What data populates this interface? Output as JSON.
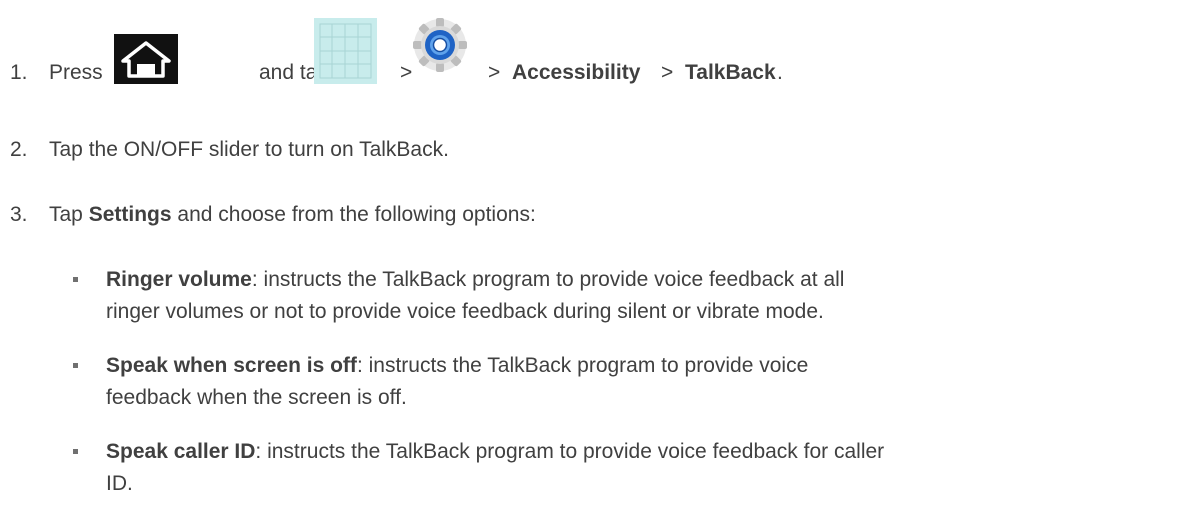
{
  "steps": [
    {
      "number": "1.",
      "press": "Press",
      "and_tap": "and tap",
      "sep1": ">",
      "sep2": ">",
      "accessibility": "Accessibility",
      "sep3": ">",
      "talkback": "TalkBack",
      "end": ".",
      "icons": [
        "home-icon",
        "apps-grid-icon",
        "settings-gear-icon"
      ]
    },
    {
      "number": "2.",
      "text": "Tap the ON/OFF slider to turn on TalkBack."
    },
    {
      "number": "3.",
      "tap": "Tap",
      "settings": "Settings",
      "rest": "and choose from the following options:"
    }
  ],
  "options": [
    {
      "term": "Ringer volume",
      "line1": ": instructs the TalkBack program to provide voice feedback at all",
      "line2": "ringer volumes or not to provide voice feedback during silent or vibrate mode."
    },
    {
      "term": "Speak when screen is off",
      "line1": ": instructs the TalkBack program to provide voice",
      "line2": "feedback when the screen is off."
    },
    {
      "term": "Speak caller ID",
      "line1": ": instructs the TalkBack program to provide voice feedback for caller",
      "line2": "ID."
    }
  ]
}
